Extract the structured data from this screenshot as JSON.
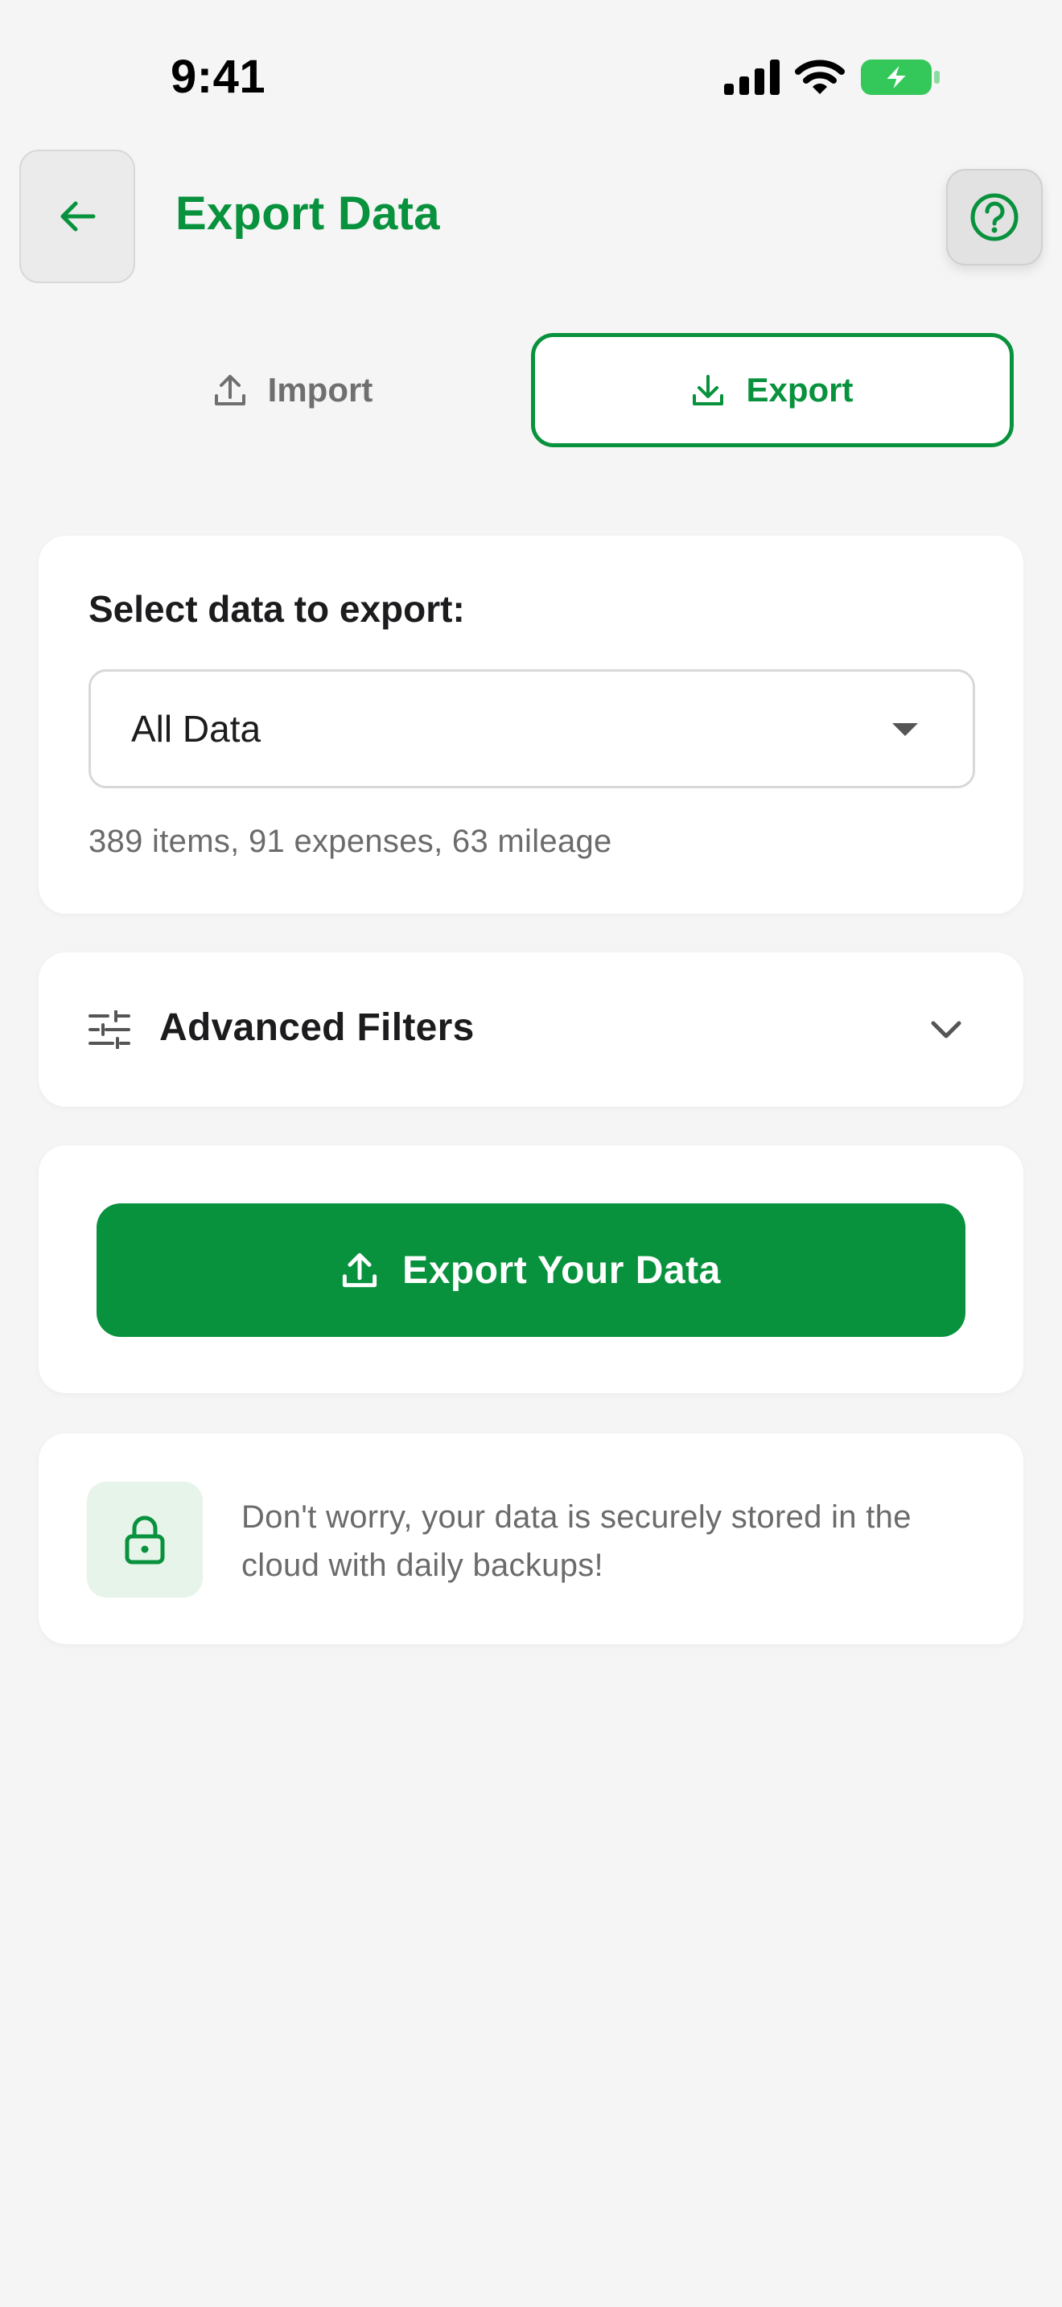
{
  "status_bar": {
    "time": "9:41",
    "icons": [
      "cellular-signal-icon",
      "wifi-icon",
      "battery-charging-icon"
    ]
  },
  "header": {
    "title": "Export Data",
    "back_icon": "arrow-left-icon",
    "help_icon": "question-circle-icon"
  },
  "tabs": [
    {
      "label": "Import",
      "icon": "upload-icon",
      "selected": false
    },
    {
      "label": "Export",
      "icon": "download-icon",
      "selected": true
    }
  ],
  "select_card": {
    "label": "Select data to export:",
    "selected_value": "All Data",
    "summary": "389 items, 91 expenses, 63 mileage"
  },
  "filters_card": {
    "label": "Advanced Filters",
    "icon": "sliders-icon",
    "chevron_icon": "chevron-down-icon"
  },
  "export_card": {
    "button_label": "Export Your Data",
    "icon": "upload-icon"
  },
  "security_card": {
    "icon": "lock-icon",
    "message": "Don't worry, your data is securely stored in the cloud with daily backups!"
  },
  "colors": {
    "accent": "#08923d",
    "background": "#f5f5f5",
    "card": "#ffffff",
    "muted_text": "#6b6b6b",
    "lock_tile": "#e7f4ea"
  }
}
